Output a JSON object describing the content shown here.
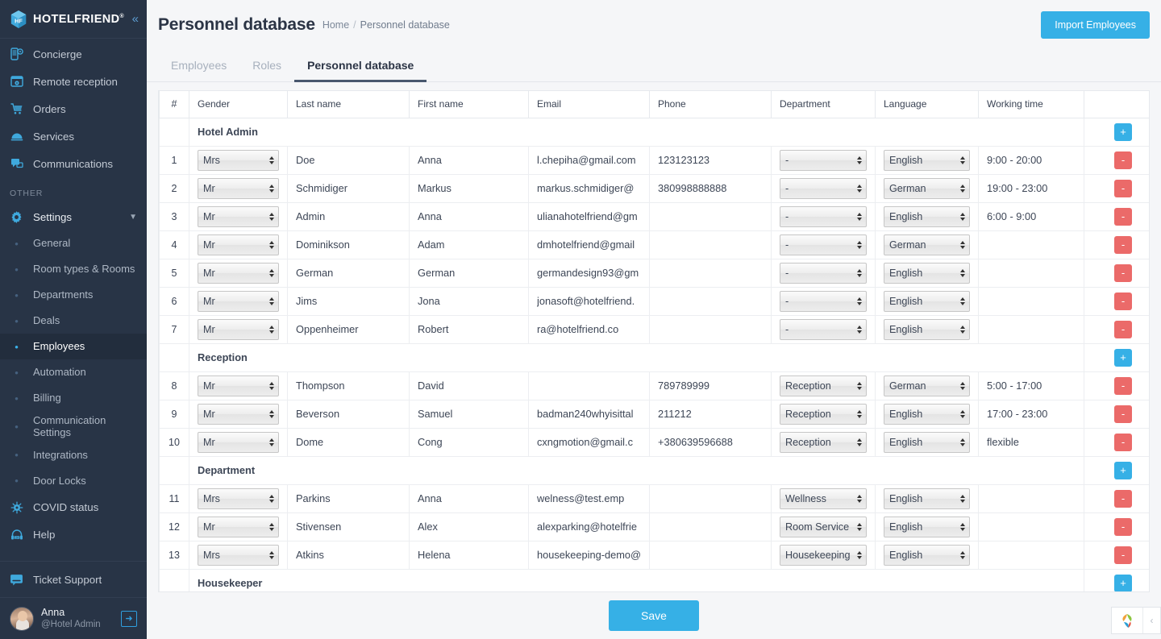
{
  "sidebar": {
    "brand": {
      "name": "HOTELFRIEND",
      "trademark": "®",
      "logo_icon": "cube-logo-icon",
      "collapse_icon": "chevron-double-left-icon"
    },
    "items": [
      {
        "label": "Concierge",
        "icon": "concierge-phone-icon"
      },
      {
        "label": "Remote reception",
        "icon": "remote-reception-icon"
      },
      {
        "label": "Orders",
        "icon": "cart-icon"
      },
      {
        "label": "Services",
        "icon": "room-service-dome-icon"
      },
      {
        "label": "Communications",
        "icon": "chat-bubbles-icon"
      }
    ],
    "section_label": "OTHER",
    "settings": {
      "label": "Settings",
      "icon": "gear-icon",
      "chevron": "chevron-down-icon"
    },
    "sub_items": [
      {
        "label": "General",
        "active": false
      },
      {
        "label": "Room types & Rooms",
        "active": false
      },
      {
        "label": "Departments",
        "active": false
      },
      {
        "label": "Deals",
        "active": false
      },
      {
        "label": "Employees",
        "active": true
      },
      {
        "label": "Automation",
        "active": false
      },
      {
        "label": "Billing",
        "active": false
      },
      {
        "label": "Communication Settings",
        "active": false
      },
      {
        "label": "Integrations",
        "active": false
      },
      {
        "label": "Door Locks",
        "active": false
      }
    ],
    "covid": {
      "label": "COVID status",
      "icon": "virus-icon"
    },
    "help": {
      "label": "Help",
      "icon": "headset-24-icon"
    },
    "ticket_support": {
      "label": "Ticket Support",
      "icon": "support-chat-icon"
    },
    "user": {
      "name": "Anna",
      "handle": "@Hotel Admin",
      "avatar_icon": "user-avatar",
      "logout_icon": "logout-arrow-icon"
    }
  },
  "header": {
    "title": "Personnel database",
    "breadcrumb": {
      "home": "Home",
      "separator": "/",
      "current": "Personnel database"
    },
    "import_button": "Import Employees"
  },
  "tabs": [
    {
      "label": "Employees",
      "active": false
    },
    {
      "label": "Roles",
      "active": false
    },
    {
      "label": "Personnel database",
      "active": true
    }
  ],
  "table": {
    "columns": [
      "#",
      "Gender",
      "Last name",
      "First name",
      "Email",
      "Phone",
      "Department",
      "Language",
      "Working time",
      ""
    ],
    "add_icon": "plus-icon",
    "remove_icon": "minus-icon",
    "groups": [
      {
        "name": "Hotel Admin",
        "rows": [
          {
            "num": "1",
            "gender": "Mrs",
            "last": "Doe",
            "first": "Anna",
            "email": "l.chepiha@gmail.com",
            "phone": "123123123",
            "department": "-",
            "language": "English",
            "working": "9:00 - 20:00"
          },
          {
            "num": "2",
            "gender": "Mr",
            "last": "Schmidiger",
            "first": "Markus",
            "email": "markus.schmidiger@",
            "phone": "380998888888",
            "department": "-",
            "language": "German",
            "working": "19:00 - 23:00"
          },
          {
            "num": "3",
            "gender": "Mr",
            "last": "Admin",
            "first": "Anna",
            "email": "ulianahotelfriend@gm",
            "phone": "",
            "department": "-",
            "language": "English",
            "working": "6:00 - 9:00"
          },
          {
            "num": "4",
            "gender": "Mr",
            "last": "Dominikson",
            "first": "Adam",
            "email": "dmhotelfriend@gmail",
            "phone": "",
            "department": "-",
            "language": "German",
            "working": ""
          },
          {
            "num": "5",
            "gender": "Mr",
            "last": "German",
            "first": "German",
            "email": "germandesign93@gm",
            "phone": "",
            "department": "-",
            "language": "English",
            "working": ""
          },
          {
            "num": "6",
            "gender": "Mr",
            "last": "Jims",
            "first": "Jona",
            "email": "jonasoft@hotelfriend.",
            "phone": "",
            "department": "-",
            "language": "English",
            "working": ""
          },
          {
            "num": "7",
            "gender": "Mr",
            "last": "Oppenheimer",
            "first": "Robert",
            "email": "ra@hotelfriend.co",
            "phone": "",
            "department": "-",
            "language": "English",
            "working": ""
          }
        ]
      },
      {
        "name": "Reception",
        "rows": [
          {
            "num": "8",
            "gender": "Mr",
            "last": "Thompson",
            "first": "David",
            "email": "",
            "phone": "789789999",
            "department": "Reception",
            "language": "German",
            "working": "5:00 - 17:00"
          },
          {
            "num": "9",
            "gender": "Mr",
            "last": "Beverson",
            "first": "Samuel",
            "email": "badman240whyisittal",
            "phone": "211212",
            "department": "Reception",
            "language": "English",
            "working": "17:00 - 23:00"
          },
          {
            "num": "10",
            "gender": "Mr",
            "last": "Dome",
            "first": "Cong",
            "email": "cxngmotion@gmail.c",
            "phone": "+380639596688",
            "department": "Reception",
            "language": "English",
            "working": "flexible"
          }
        ]
      },
      {
        "name": "Department",
        "rows": [
          {
            "num": "11",
            "gender": "Mrs",
            "last": "Parkins",
            "first": "Anna",
            "email": "welness@test.emp",
            "phone": "",
            "department": "Wellness",
            "language": "English",
            "working": ""
          },
          {
            "num": "12",
            "gender": "Mr",
            "last": "Stivensen",
            "first": "Alex",
            "email": "alexparking@hotelfrie",
            "phone": "",
            "department": "Room Service",
            "language": "English",
            "working": ""
          },
          {
            "num": "13",
            "gender": "Mrs",
            "last": "Atkins",
            "first": "Helena",
            "email": "housekeeping-demo@",
            "phone": "",
            "department": "Housekeeping",
            "language": "English",
            "working": ""
          }
        ]
      },
      {
        "name": "Housekeeper",
        "rows": []
      }
    ]
  },
  "footer": {
    "save_button": "Save",
    "chat_widget": {
      "logo_icon": "zoho-leaf-icon",
      "toggle_icon": "chevron-left-icon"
    }
  },
  "colors": {
    "accent": "#36b0e6",
    "sidebar_bg": "#283446",
    "danger": "#eb6a69",
    "page_bg": "#f5f6f8"
  }
}
